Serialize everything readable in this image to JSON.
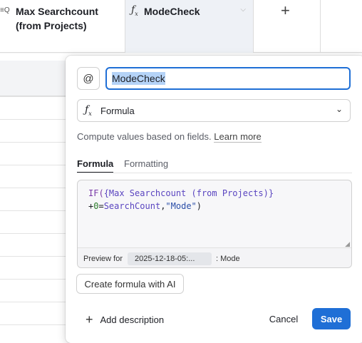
{
  "grid": {
    "columns": [
      {
        "name": "Max Searchcount (from Projects)",
        "icon": "lookup-icon",
        "icon_glyph": "≡Q"
      },
      {
        "name": "ModeCheck",
        "icon": "formula-icon",
        "icon_glyph": "fx"
      }
    ],
    "add_column_icon": "plus-icon"
  },
  "field_editor": {
    "field_name": "ModeCheck",
    "field_type": "Formula",
    "description_text": "Compute values based on fields.",
    "learn_more_label": "Learn more",
    "tabs": [
      {
        "label": "Formula",
        "active": true
      },
      {
        "label": "Formatting",
        "active": false
      }
    ],
    "formula": {
      "line1_func": "IF(",
      "line1_ref": "{Max Searchcount (from Projects)}",
      "line2_op": "+",
      "line2_num": "0",
      "line2_eq": "=",
      "line2_field": "SearchCount",
      "line2_comma": ",",
      "line2_str": "\"Mode\"",
      "line2_close": ")"
    },
    "preview": {
      "label": "Preview for",
      "record": "2025-12-18-05:...",
      "value": ": Mode"
    },
    "ai_button_label": "Create formula with AI",
    "add_description_label": "Add description",
    "cancel_label": "Cancel",
    "save_label": "Save"
  },
  "colors": {
    "accent": "#1f6fd6",
    "selection": "#b5d3f7",
    "header_active": "#eef1f6"
  }
}
